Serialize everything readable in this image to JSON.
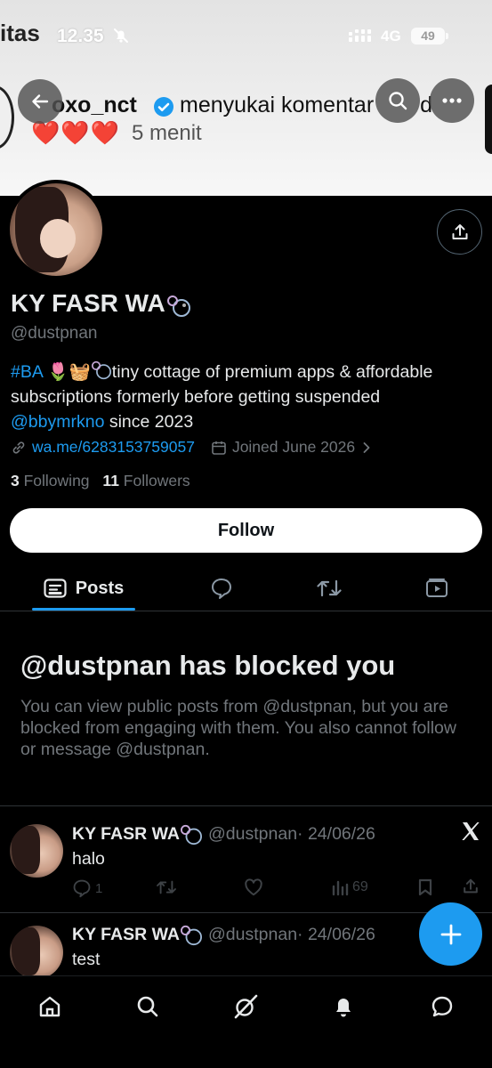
{
  "status_bar": {
    "prev_app": "itas",
    "time": "12.35",
    "network": "4G",
    "battery": "49"
  },
  "notification": {
    "user": "oxo_nct",
    "text": "menyukai komentar",
    "text_tail": "d",
    "hearts": "❤️❤️❤️",
    "time": "5 menit"
  },
  "profile": {
    "name": "KY FASR WA",
    "handle": "@dustpnan",
    "bio_tag": "#BA",
    "bio_emojis": "🌷🧺",
    "bio_text": "tiny cottage of premium apps & affordable subscriptions formerly before getting suspended",
    "bio_mention": "@bbymrkno",
    "bio_since": "since 2023",
    "link": "wa.me/6283153759057",
    "joined": "Joined June 2026",
    "following_count": "3",
    "following_label": "Following",
    "followers_count": "11",
    "followers_label": "Followers"
  },
  "follow_button": "Follow",
  "tabs": [
    {
      "label": "Posts",
      "icon": "posts-icon",
      "active": true
    },
    {
      "label": "",
      "icon": "replies-icon"
    },
    {
      "label": "",
      "icon": "reposts-icon"
    },
    {
      "label": "",
      "icon": "media-icon"
    }
  ],
  "blocked": {
    "title": "@dustpnan has blocked you",
    "message": "You can view public posts from @dustpnan, but you are blocked from engaging with them. You also cannot follow or message @dustpnan."
  },
  "tweets": [
    {
      "name": "KY FASR WA",
      "handle": "@dustpnan",
      "date": "· 24/06/26",
      "body": "halo",
      "replies": "1",
      "views": "69"
    },
    {
      "name": "KY FASR WA",
      "handle": "@dustpnan",
      "date": "· 24/06/26",
      "body": "test"
    }
  ],
  "colors": {
    "accent": "#1d9bf0",
    "background": "#000000",
    "secondary_text": "#71767b"
  },
  "bottom_nav": [
    "home-icon",
    "search-icon",
    "grok-icon",
    "notifications-icon",
    "messages-icon"
  ]
}
